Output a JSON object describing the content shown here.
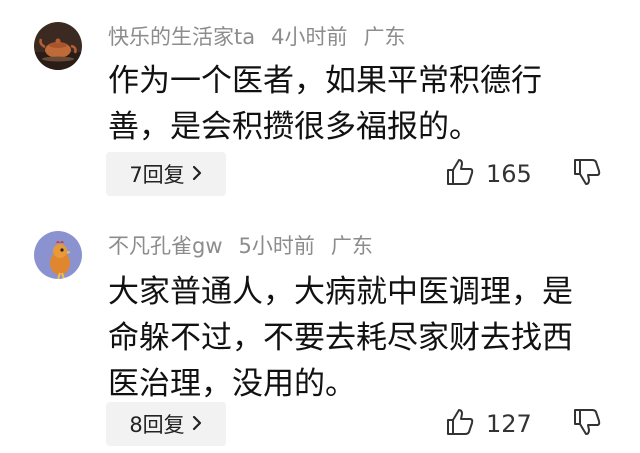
{
  "comments": [
    {
      "username": "快乐的生活家ta",
      "time": "4小时前",
      "location": "广东",
      "text_lines": [
        "作为一个医者，如果平常积德行",
        "善，是会积攒很多福报的。"
      ],
      "reply_label": "7回复",
      "like_count": "165",
      "avatar_icon": "teapot-avatar"
    },
    {
      "username": "不凡孔雀gw",
      "time": "5小时前",
      "location": "广东",
      "text_lines": [
        "大家普通人，大病就中医调理，是",
        "命躲不过，不要去耗尽家财去找西",
        "医治理，没用的。"
      ],
      "reply_label": "8回复",
      "like_count": "127",
      "avatar_icon": "rooster-avatar"
    }
  ],
  "icons": {
    "like": "thumbs-up-icon",
    "dislike": "thumbs-down-icon",
    "reply_chevron": "chevron-right-icon"
  },
  "colors": {
    "meta_text": "#8c8c8c",
    "reply_bg": "#f2f2f2"
  }
}
